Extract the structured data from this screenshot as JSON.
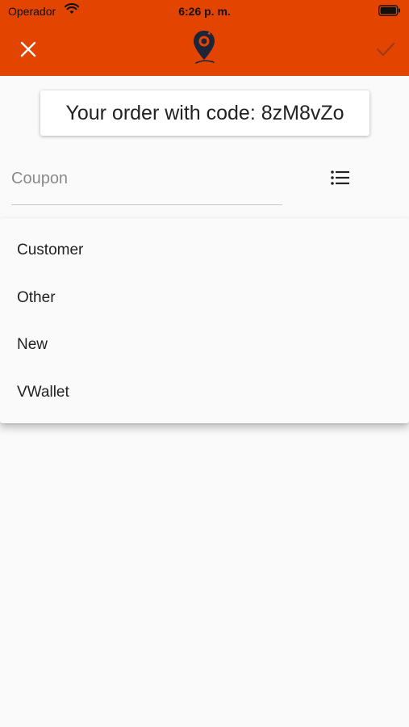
{
  "statusbar": {
    "carrier": "Operador",
    "time": "6:26 p. m."
  },
  "header": {
    "close_icon": "close-icon",
    "logo_icon": "location-pin-logo",
    "check_icon": "check-icon",
    "background": "#e34400"
  },
  "order": {
    "text": "Your order with code: 8zM8vZo"
  },
  "coupon": {
    "placeholder": "Coupon",
    "value": "",
    "list_icon": "list-icon"
  },
  "dropdown": {
    "items": [
      {
        "label": "Customer"
      },
      {
        "label": "Other"
      },
      {
        "label": "New"
      },
      {
        "label": "VWallet"
      }
    ]
  }
}
